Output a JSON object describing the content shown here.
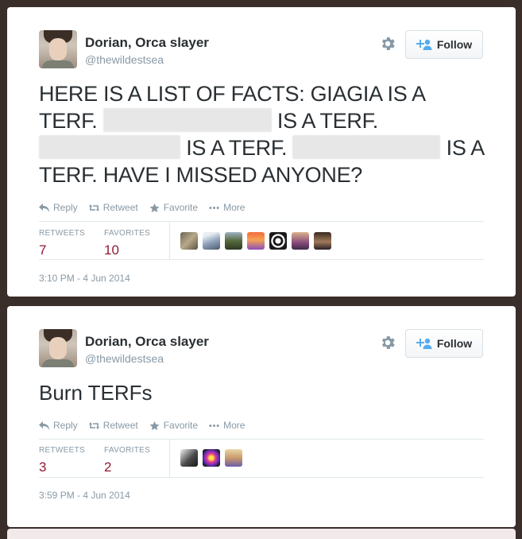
{
  "tweets": [
    {
      "user": {
        "name": "Dorian, Orca slayer",
        "handle": "@thewildestsea"
      },
      "follow_label": "Follow",
      "text": {
        "seg1": "HERE IS A LIST OF FACTS: GIAGIA IS A TERF.",
        "seg2": "IS A TERF.",
        "seg3": "IS A TERF.",
        "seg4": "IS A TERF. HAVE I MISSED ANYONE?"
      },
      "actions": {
        "reply": "Reply",
        "retweet": "Retweet",
        "favorite": "Favorite",
        "more": "More"
      },
      "stats": {
        "retweets_label": "RETWEETS",
        "retweets": "7",
        "favorites_label": "FAVORITES",
        "favorites": "10"
      },
      "favoriter_avatar_count": 7,
      "timestamp": "3:10 PM - 4 Jun 2014"
    },
    {
      "user": {
        "name": "Dorian, Orca slayer",
        "handle": "@thewildestsea"
      },
      "follow_label": "Follow",
      "text": {
        "body": "Burn TERFs"
      },
      "actions": {
        "reply": "Reply",
        "retweet": "Retweet",
        "favorite": "Favorite",
        "more": "More"
      },
      "stats": {
        "retweets_label": "RETWEETS",
        "retweets": "3",
        "favorites_label": "FAVORITES",
        "favorites": "2"
      },
      "favoriter_avatar_count": 3,
      "timestamp": "3:59 PM - 4 Jun 2014"
    }
  ],
  "colors": {
    "accent_number": "#8c1c33",
    "muted": "#8899a6",
    "text": "#292f33",
    "background": "#3a2e2b"
  }
}
